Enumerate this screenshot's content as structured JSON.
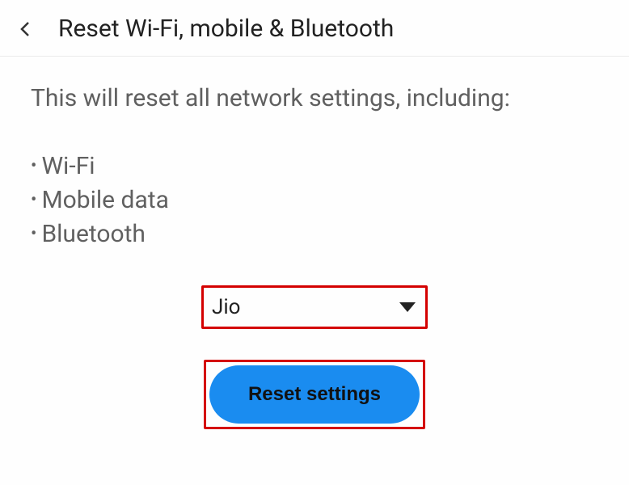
{
  "header": {
    "title": "Reset Wi-Fi, mobile & Bluetooth"
  },
  "content": {
    "description": "This will reset all network settings, including:",
    "bullets": [
      "Wi-Fi",
      "Mobile data",
      "Bluetooth"
    ]
  },
  "dropdown": {
    "selected": "Jio"
  },
  "button": {
    "label": "Reset settings"
  },
  "highlight_color": "#d40000",
  "accent_color": "#1a8cf0"
}
